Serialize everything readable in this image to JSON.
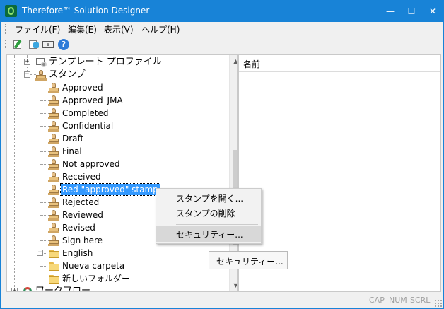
{
  "window": {
    "title": "Therefore™ Solution Designer",
    "controls": {
      "minimize": "—",
      "maximize": "☐",
      "close": "✕"
    }
  },
  "menubar": {
    "items": [
      {
        "label": "ファイル(F)"
      },
      {
        "label": "編集(E)"
      },
      {
        "label": "表示(V)"
      },
      {
        "label": "ヘルプ(H)"
      }
    ]
  },
  "toolbar": {
    "buttons": [
      {
        "icon": "check-document-icon"
      },
      {
        "icon": "check-document-green-icon"
      },
      {
        "icon": "text-box-icon",
        "text": "A"
      },
      {
        "icon": "help-icon",
        "text": "?"
      }
    ]
  },
  "tree": {
    "template_profiles": "テンプレート プロファイル",
    "stamps": "スタンプ",
    "stamp_items": [
      "Approved",
      "Approved_JMA",
      "Completed",
      "Confidential",
      "Draft",
      "Final",
      "Not approved",
      "Received",
      "Red \"approved\" stamp",
      "Rejected",
      "Reviewed",
      "Revised",
      "Sign here"
    ],
    "selected_index": 8,
    "folders": [
      {
        "label": "English",
        "expandable": true
      },
      {
        "label": "Nueva carpeta",
        "expandable": false
      },
      {
        "label": "新しいフォルダー",
        "expandable": false
      }
    ],
    "workflow": "ワークフロー",
    "expander_plus": "+",
    "expander_minus": "−"
  },
  "list": {
    "column_header": "名前"
  },
  "context_menu": {
    "items": [
      {
        "label": "スタンプを開く..."
      },
      {
        "label": "スタンプの削除"
      },
      {
        "label": "セキュリティー...",
        "highlighted": true
      }
    ]
  },
  "floating_button": {
    "label": "セキュリティー..."
  },
  "statusbar": {
    "indicators": [
      "CAP",
      "NUM",
      "SCRL"
    ]
  }
}
